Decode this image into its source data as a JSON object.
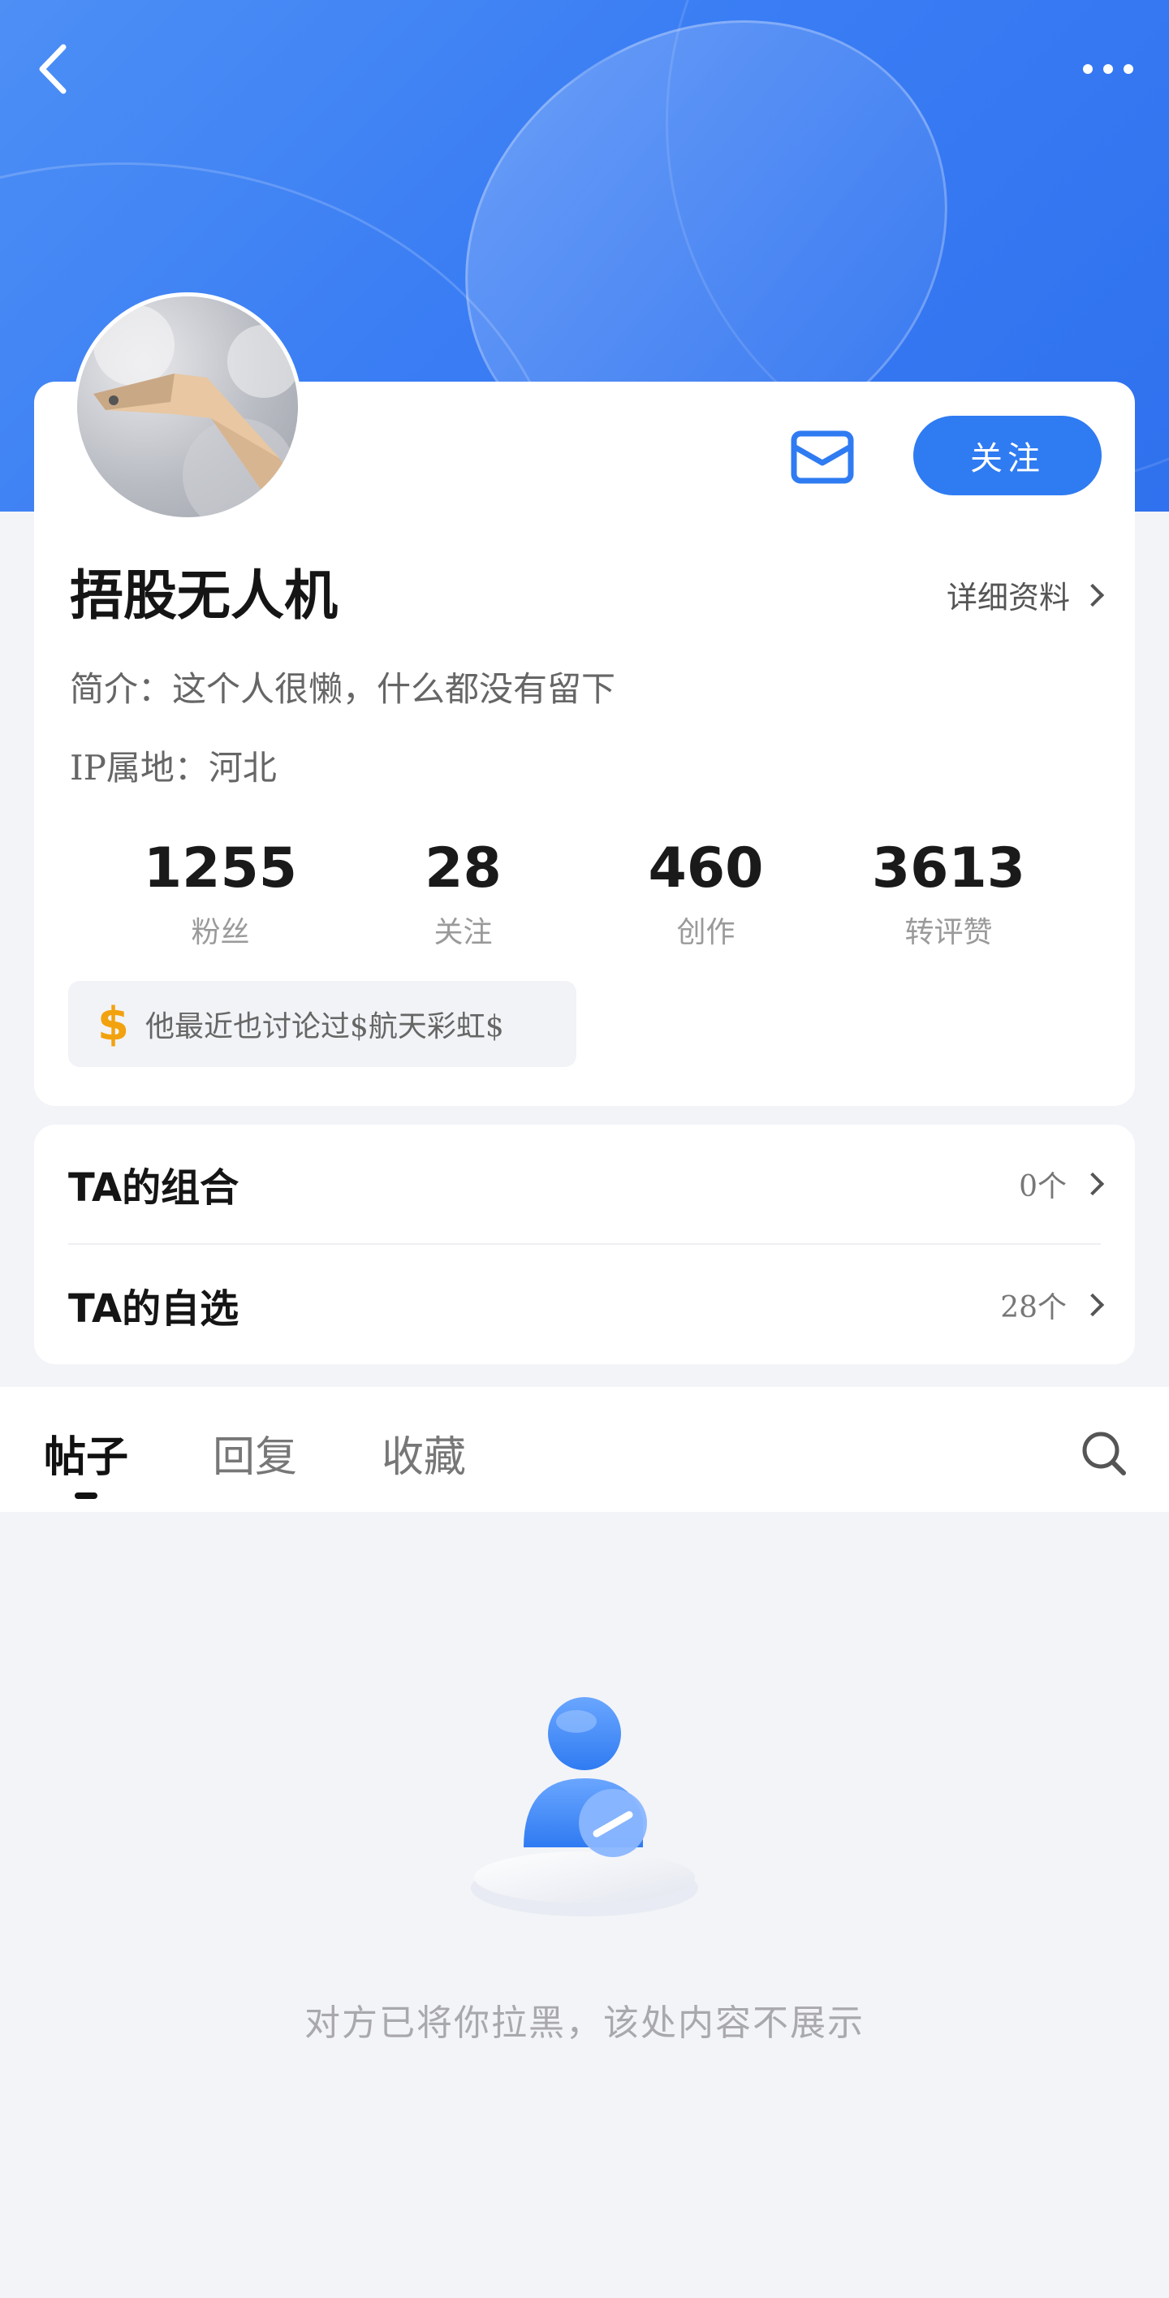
{
  "header": {
    "back_icon": "chevron-left-icon",
    "more_icon": "more-dots-icon"
  },
  "profile": {
    "username": "捂股无人机",
    "detail_label": "详细资料",
    "bio": "简介：这个人很懒，什么都没有留下",
    "ip_location": "IP属地：河北",
    "follow_label": "关注",
    "message_icon": "mail-icon"
  },
  "stats": [
    {
      "value": "1255",
      "label": "粉丝"
    },
    {
      "value": "28",
      "label": "关注"
    },
    {
      "value": "460",
      "label": "创作"
    },
    {
      "value": "3613",
      "label": "转评赞"
    }
  ],
  "discussion": {
    "icon": "dollar-icon",
    "text": "他最近也讨论过$航天彩虹$"
  },
  "lists": [
    {
      "title": "TA的组合",
      "count": "0个"
    },
    {
      "title": "TA的自选",
      "count": "28个"
    }
  ],
  "tabs": [
    {
      "label": "帖子",
      "active": true
    },
    {
      "label": "回复",
      "active": false
    },
    {
      "label": "收藏",
      "active": false
    }
  ],
  "search_icon": "search-icon",
  "empty_state": {
    "icon": "blocked-user-icon",
    "text": "对方已将你拉黑，该处内容不展示"
  },
  "colors": {
    "accent": "#2f7bf2",
    "gold": "#f2a20e",
    "background": "#f3f4f8"
  }
}
